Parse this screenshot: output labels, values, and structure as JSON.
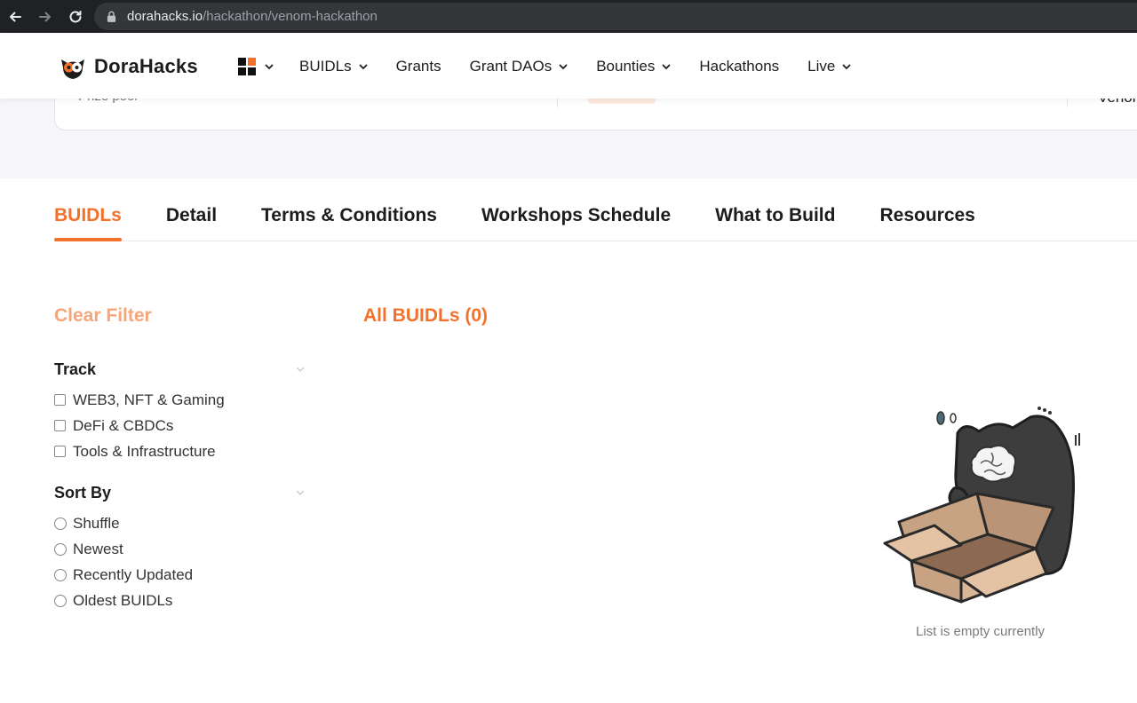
{
  "browser": {
    "url_host": "dorahacks.io",
    "url_path": "/hackathon/venom-hackathon"
  },
  "header": {
    "brand": "DoraHacks",
    "nav": [
      {
        "label": "BUIDLs",
        "has_dropdown": true
      },
      {
        "label": "Grants",
        "has_dropdown": false
      },
      {
        "label": "Grant DAOs",
        "has_dropdown": true
      },
      {
        "label": "Bounties",
        "has_dropdown": true
      },
      {
        "label": "Hackathons",
        "has_dropdown": false
      },
      {
        "label": "Live",
        "has_dropdown": true
      }
    ]
  },
  "card": {
    "left_text": "Prize pool",
    "right_text": "Venom"
  },
  "tabs": [
    {
      "label": "BUIDLs",
      "active": true
    },
    {
      "label": "Detail",
      "active": false
    },
    {
      "label": "Terms & Conditions",
      "active": false
    },
    {
      "label": "Workshops Schedule",
      "active": false
    },
    {
      "label": "What to Build",
      "active": false
    },
    {
      "label": "Resources",
      "active": false
    }
  ],
  "filters": {
    "clear_label": "Clear Filter",
    "track": {
      "title": "Track",
      "options": [
        "WEB3, NFT & Gaming",
        "DeFi & CBDCs",
        "Tools & Infrastructure"
      ]
    },
    "sort": {
      "title": "Sort By",
      "options": [
        "Shuffle",
        "Newest",
        "Recently Updated",
        "Oldest BUIDLs"
      ]
    }
  },
  "main": {
    "heading": "All BUIDLs (0)",
    "empty_text": "List is empty currently"
  },
  "colors": {
    "accent": "#f2722c",
    "accent_light": "#f5a67a",
    "chrome_bg": "#202124"
  }
}
